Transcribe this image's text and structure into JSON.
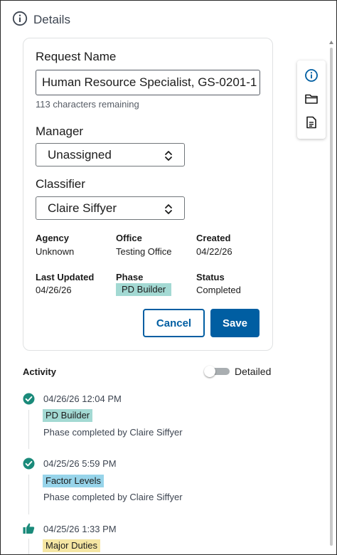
{
  "header": {
    "title": "Details",
    "icon": "info-icon"
  },
  "form": {
    "request_name_label": "Request Name",
    "request_name_value": "Human Resource Specialist, GS-0201-1",
    "chars_remaining": "113 characters remaining",
    "manager_label": "Manager",
    "manager_value": "Unassigned",
    "classifier_label": "Classifier",
    "classifier_value": "Claire Siffyer"
  },
  "meta": {
    "agency_label": "Agency",
    "agency_value": "Unknown",
    "office_label": "Office",
    "office_value": "Testing Office",
    "created_label": "Created",
    "created_value": "04/22/26",
    "updated_label": "Last Updated",
    "updated_value": "04/26/26",
    "phase_label": "Phase",
    "phase_value": "PD Builder",
    "status_label": "Status",
    "status_value": "Completed"
  },
  "actions": {
    "cancel_label": "Cancel",
    "save_label": "Save"
  },
  "toolbar": {
    "items": [
      "info-icon",
      "folder-icon",
      "document-icon"
    ]
  },
  "activity": {
    "title": "Activity",
    "toggle_label": "Detailed",
    "toggle_on": false,
    "events": [
      {
        "icon": "check-circle-icon",
        "date": "04/26/26 12:04 PM",
        "tag": "PD Builder",
        "desc": "Phase completed by Claire Siffyer"
      },
      {
        "icon": "check-circle-icon",
        "date": "04/25/26 5:59 PM",
        "tag": "Factor Levels",
        "desc": "Phase completed by Claire Siffyer"
      },
      {
        "icon": "thumbs-up-icon",
        "date": "04/25/26 1:33 PM",
        "tag": "Major Duties",
        "desc": ""
      }
    ]
  },
  "colors": {
    "primary": "#005ea2",
    "success": "#1a8a7a",
    "tag_teal": "#97d4ea",
    "tag_pd": "#a3d9d3",
    "tag_yellow": "#f5e6a3"
  }
}
